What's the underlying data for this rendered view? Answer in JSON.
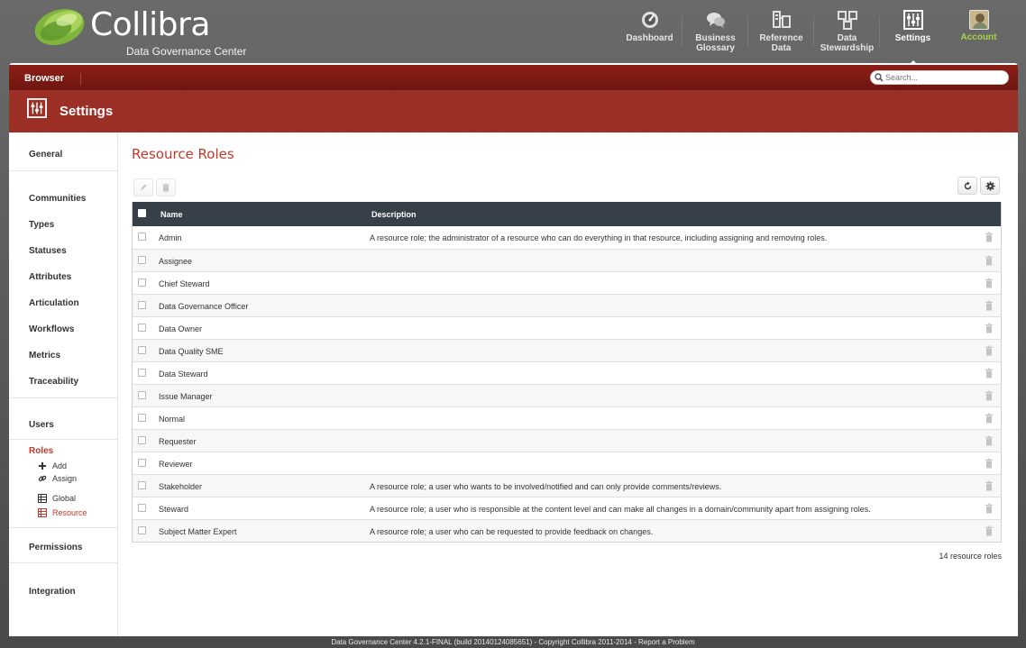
{
  "brand": {
    "name": "Collibra",
    "subtitle": "Data Governance Center"
  },
  "topnav": {
    "items": [
      {
        "label": "Dashboard",
        "icon": "dashboard-icon"
      },
      {
        "label": "Business Glossary",
        "icon": "glossary-chat-icon"
      },
      {
        "label": "Reference Data",
        "icon": "reference-data-icon"
      },
      {
        "label": "Data Stewardship",
        "icon": "stewardship-icon"
      },
      {
        "label": "Settings",
        "icon": "settings-sliders-icon"
      },
      {
        "label": "Account",
        "icon": "account-avatar"
      }
    ]
  },
  "browserbar": {
    "label": "Browser",
    "search_placeholder": "Search..."
  },
  "pageheader": {
    "title": "Settings"
  },
  "sidebar": {
    "items": [
      {
        "label": "General"
      },
      {
        "label": "Communities"
      },
      {
        "label": "Types"
      },
      {
        "label": "Statuses"
      },
      {
        "label": "Attributes"
      },
      {
        "label": "Articulation"
      },
      {
        "label": "Workflows"
      },
      {
        "label": "Metrics"
      },
      {
        "label": "Traceability"
      },
      {
        "label": "Users"
      },
      {
        "label": "Roles"
      },
      {
        "label": "Permissions"
      },
      {
        "label": "Integration"
      }
    ],
    "role_actions": [
      {
        "label": "Add",
        "icon": "plus-icon"
      },
      {
        "label": "Assign",
        "icon": "link-icon"
      }
    ],
    "role_views": [
      {
        "label": "Global",
        "icon": "table-icon"
      },
      {
        "label": "Resource",
        "icon": "table-icon"
      }
    ]
  },
  "content": {
    "title": "Resource Roles",
    "columns": {
      "name": "Name",
      "description": "Description"
    },
    "rows": [
      {
        "name": "Admin",
        "description": "A resource role; the administrator of a resource who can do everything in that resource, including assigning and removing roles."
      },
      {
        "name": "Assignee",
        "description": ""
      },
      {
        "name": "Chief Steward",
        "description": ""
      },
      {
        "name": "Data Governance Officer",
        "description": ""
      },
      {
        "name": "Data Owner",
        "description": ""
      },
      {
        "name": "Data Quality SME",
        "description": ""
      },
      {
        "name": "Data Steward",
        "description": ""
      },
      {
        "name": "Issue Manager",
        "description": ""
      },
      {
        "name": "Normal",
        "description": ""
      },
      {
        "name": "Requester",
        "description": ""
      },
      {
        "name": "Reviewer",
        "description": ""
      },
      {
        "name": "Stakeholder",
        "description": "A resource role; a user who wants to be involved/notified and can only provide comments/reviews."
      },
      {
        "name": "Steward",
        "description": "A resource role; a user who is responsible at the content level and can make all changes in a domain/community apart from assigning roles."
      },
      {
        "name": "Subject Matter Expert",
        "description": "A resource role; a user who can be requested to provide feedback on changes."
      }
    ],
    "count_label": "14 resource roles"
  },
  "footer": {
    "text": "Data Governance Center 4.2.1-FINAL (build 20140124085651) - Copyright Collibra 2011-2014 - ",
    "link": "Report a Problem"
  },
  "colors": {
    "brand_red": "#9a2c23",
    "accent_red": "#c0392b",
    "table_header": "#373f49",
    "account_green": "#a6d14a"
  }
}
